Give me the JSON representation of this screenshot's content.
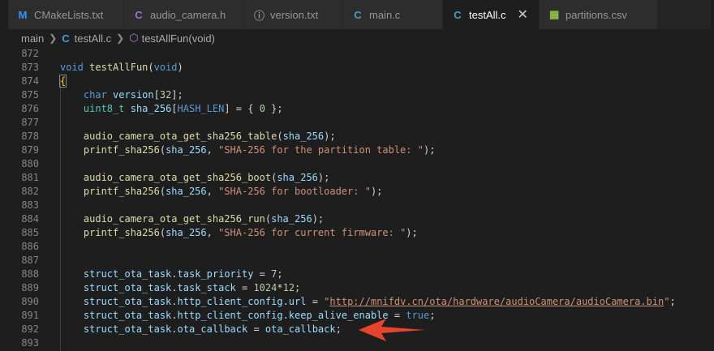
{
  "tabs": [
    {
      "label": "CMakeLists.txt",
      "icon": "M",
      "icon_name": "cmake-icon"
    },
    {
      "label": "audio_camera.h",
      "icon": "C",
      "icon_name": "c-header-icon"
    },
    {
      "label": "version.txt",
      "icon": "ⓘ",
      "icon_name": "info-icon"
    },
    {
      "label": "main.c",
      "icon": "C",
      "icon_name": "c-file-icon"
    },
    {
      "label": "testAll.c",
      "icon": "C",
      "icon_name": "c-file-icon",
      "active": true
    },
    {
      "label": "partitions.csv",
      "icon": "▦",
      "icon_name": "table-icon"
    }
  ],
  "close_glyph": "✕",
  "breadcrumb": {
    "folder": "main",
    "file": "testAll.c",
    "symbol": "testAllFun(void)",
    "file_icon": "C",
    "symbol_icon": "⬡"
  },
  "lines": [
    {
      "n": "872",
      "t": ""
    },
    {
      "n": "873",
      "t": "void testAllFun(void)"
    },
    {
      "n": "874",
      "t": "{"
    },
    {
      "n": "875",
      "t": "    char version[32];"
    },
    {
      "n": "876",
      "t": "    uint8_t sha_256[HASH_LEN] = { 0 };"
    },
    {
      "n": "877",
      "t": ""
    },
    {
      "n": "878",
      "t": "    audio_camera_ota_get_sha256_table(sha_256);"
    },
    {
      "n": "879",
      "t": "    printf_sha256(sha_256, \"SHA-256 for the partition table: \");"
    },
    {
      "n": "880",
      "t": ""
    },
    {
      "n": "881",
      "t": "    audio_camera_ota_get_sha256_boot(sha_256);"
    },
    {
      "n": "882",
      "t": "    printf_sha256(sha_256, \"SHA-256 for bootloader: \");"
    },
    {
      "n": "883",
      "t": ""
    },
    {
      "n": "884",
      "t": "    audio_camera_ota_get_sha256_run(sha_256);"
    },
    {
      "n": "885",
      "t": "    printf_sha256(sha_256, \"SHA-256 for current firmware: \");"
    },
    {
      "n": "886",
      "t": ""
    },
    {
      "n": "887",
      "t": ""
    },
    {
      "n": "888",
      "t": "    struct_ota_task.task_priority = 7;"
    },
    {
      "n": "889",
      "t": "    struct_ota_task.task_stack = 1024*12;"
    },
    {
      "n": "890",
      "t": "    struct_ota_task.http_client_config.url = \"http://mnifdv.cn/ota/hardware/audioCamera/audioCamera.bin\";"
    },
    {
      "n": "891",
      "t": "    struct_ota_task.http_client_config.keep_alive_enable = true;"
    },
    {
      "n": "892",
      "t": "    struct_ota_task.ota_callback = ota_callback;"
    },
    {
      "n": "893",
      "t": ""
    }
  ],
  "colors": {
    "keyword": "#569cd6",
    "function": "#dcdcaa",
    "variable": "#9cdcfe",
    "string": "#ce9178",
    "number": "#b5cea8",
    "type": "#4ec9b0",
    "arrow": "#e8442b"
  }
}
